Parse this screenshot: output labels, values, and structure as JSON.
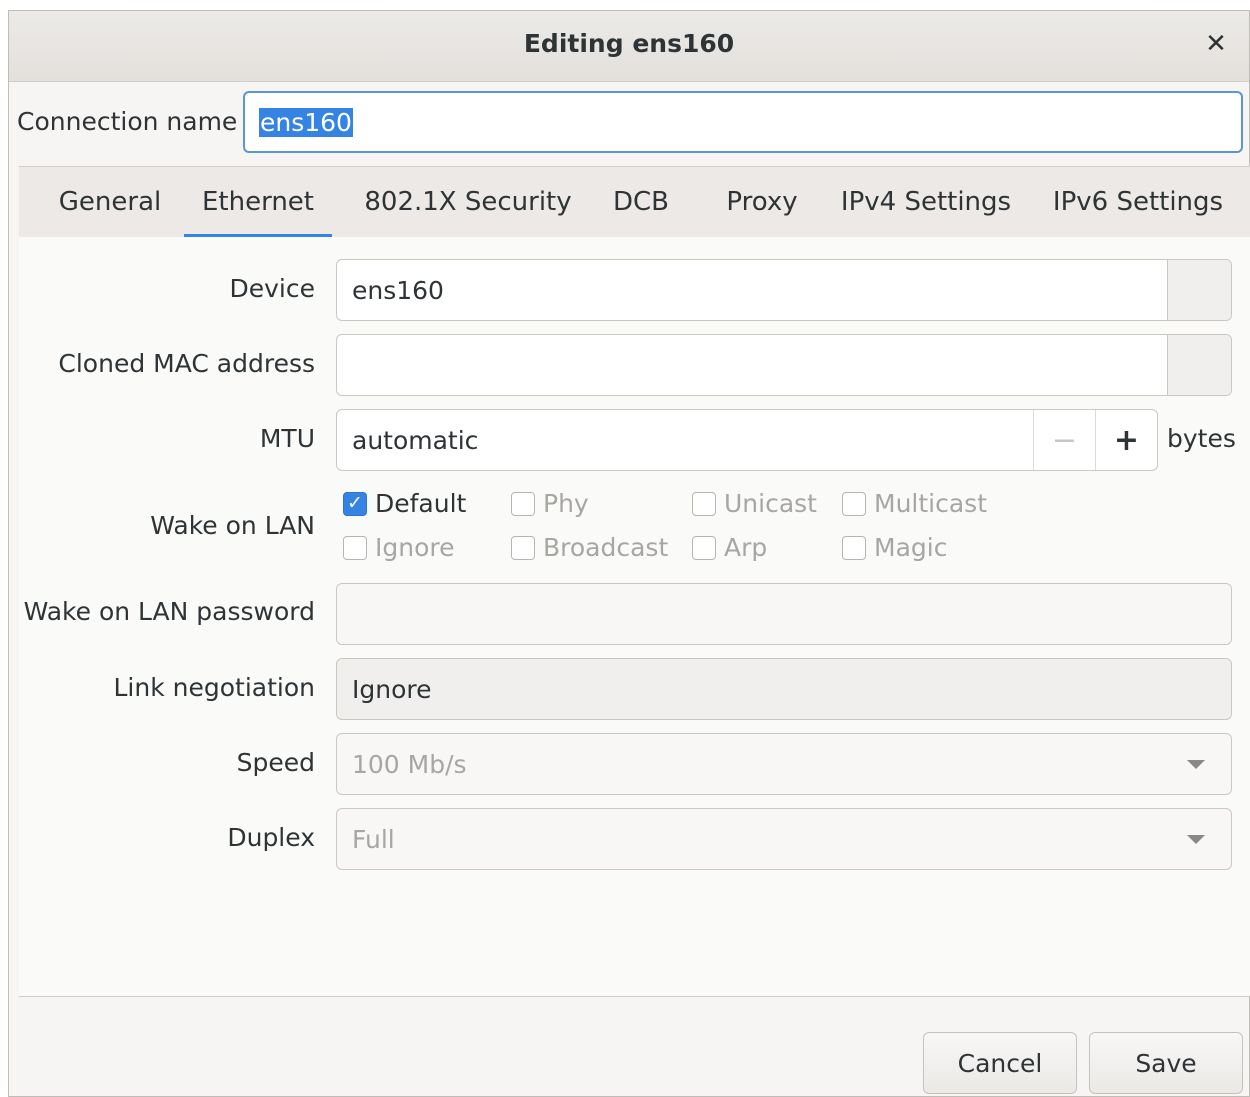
{
  "window": {
    "title": "Editing ens160",
    "close_glyph": "✕"
  },
  "connection": {
    "label": "Connection name",
    "value": "ens160"
  },
  "tabs": [
    {
      "label": "General"
    },
    {
      "label": "Ethernet",
      "active": true
    },
    {
      "label": "802.1X Security"
    },
    {
      "label": "DCB"
    },
    {
      "label": "Proxy"
    },
    {
      "label": "IPv4 Settings"
    },
    {
      "label": "IPv6 Settings"
    }
  ],
  "ethernet": {
    "device_label": "Device",
    "device_value": "ens160",
    "mac_label": "Cloned MAC address",
    "mac_value": "",
    "mtu_label": "MTU",
    "mtu_value": "automatic",
    "mtu_minus": "−",
    "mtu_plus": "+",
    "mtu_unit": "bytes",
    "wol_label": "Wake on LAN",
    "wol_options": [
      {
        "label": "Default",
        "checked": true
      },
      {
        "label": "Phy",
        "checked": false
      },
      {
        "label": "Unicast",
        "checked": false
      },
      {
        "label": "Multicast",
        "checked": false
      },
      {
        "label": "Ignore",
        "checked": false
      },
      {
        "label": "Broadcast",
        "checked": false
      },
      {
        "label": "Arp",
        "checked": false
      },
      {
        "label": "Magic",
        "checked": false
      }
    ],
    "wol_password_label": "Wake on LAN password",
    "wol_password_value": "",
    "link_label": "Link negotiation",
    "link_value": "Ignore",
    "speed_label": "Speed",
    "speed_value": "100 Mb/s",
    "duplex_label": "Duplex",
    "duplex_value": "Full"
  },
  "buttons": {
    "cancel": "Cancel",
    "save": "Save"
  },
  "colors": {
    "accent": "#3584e4"
  }
}
